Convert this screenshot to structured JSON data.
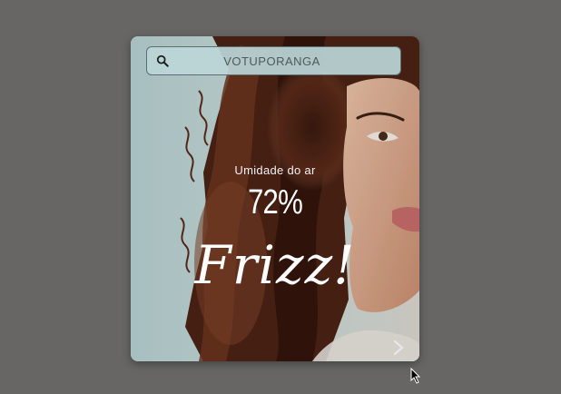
{
  "search": {
    "value": "VOTUPORANGA",
    "icon": "search-icon"
  },
  "weather": {
    "label": "Umidade do ar",
    "value": "72%",
    "status": "Frizz!"
  },
  "navigation": {
    "next_icon": "chevron-right-icon"
  },
  "colors": {
    "page_background": "#676665",
    "card_background": "#b9d3d4",
    "text": "#ffffff"
  }
}
